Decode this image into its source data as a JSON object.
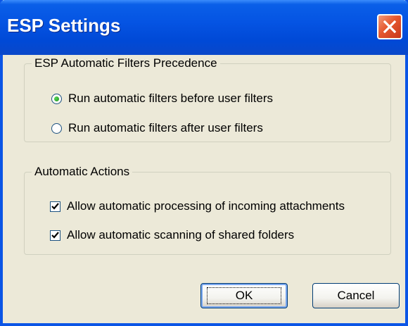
{
  "window": {
    "title": "ESP Settings",
    "close_icon": "close-icon"
  },
  "precedence_group": {
    "legend": "ESP Automatic Filters Precedence",
    "options": [
      {
        "label": "Run automatic filters before user filters",
        "selected": true
      },
      {
        "label": "Run automatic filters after user filters",
        "selected": false
      }
    ]
  },
  "actions_group": {
    "legend": "Automatic Actions",
    "options": [
      {
        "label": "Allow automatic processing of incoming attachments",
        "checked": true
      },
      {
        "label": "Allow automatic scanning of shared folders",
        "checked": true
      }
    ]
  },
  "buttons": {
    "ok_label": "OK",
    "cancel_label": "Cancel"
  },
  "colors": {
    "titlebar": "#0554e3",
    "face": "#ece9d8",
    "radio_dot": "#21a121",
    "close_button": "#e5572e"
  }
}
